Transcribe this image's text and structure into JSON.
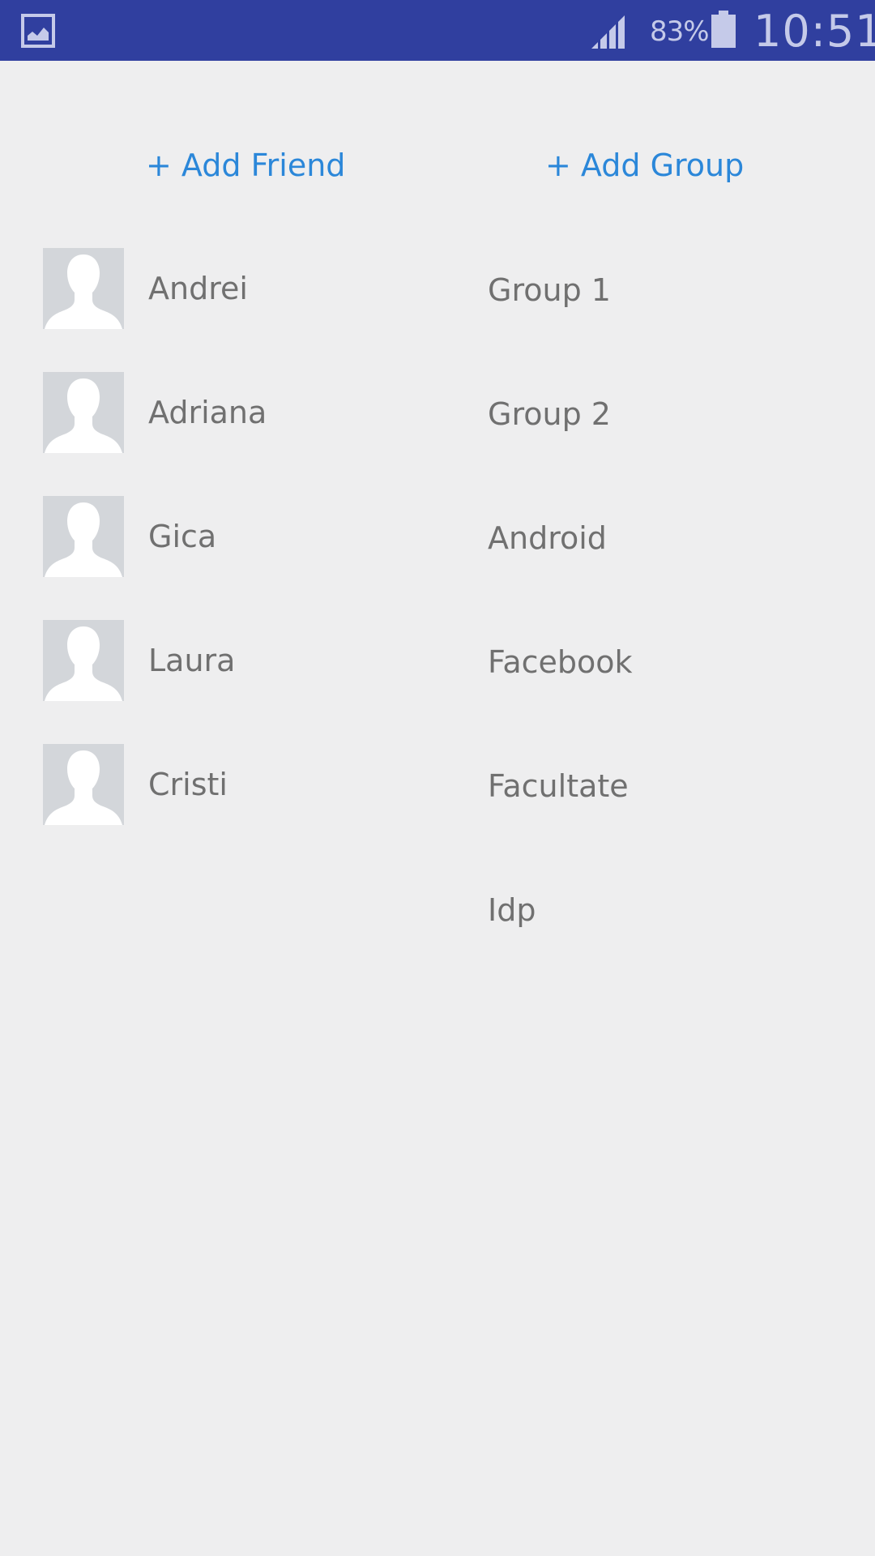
{
  "status_bar": {
    "battery_percent": "83%",
    "time": "10:51",
    "icons": [
      "gallery-icon",
      "signal-icon",
      "battery-icon"
    ],
    "colors": {
      "background": "#303f9f",
      "foreground": "#c5cae9"
    }
  },
  "actions": {
    "add_friend": "+ Add Friend",
    "add_group": "+ Add Group"
  },
  "friends": [
    {
      "name": "Andrei"
    },
    {
      "name": "Adriana"
    },
    {
      "name": "Gica"
    },
    {
      "name": "Laura"
    },
    {
      "name": "Cristi"
    }
  ],
  "groups": [
    {
      "name": "Group 1"
    },
    {
      "name": "Group 2"
    },
    {
      "name": "Android"
    },
    {
      "name": "Facebook"
    },
    {
      "name": "Facultate"
    },
    {
      "name": "Idp"
    }
  ],
  "colors": {
    "accent": "#2b87d9",
    "text": "#707070",
    "background": "#eeeeef",
    "avatar_placeholder": "#d3d6da"
  }
}
